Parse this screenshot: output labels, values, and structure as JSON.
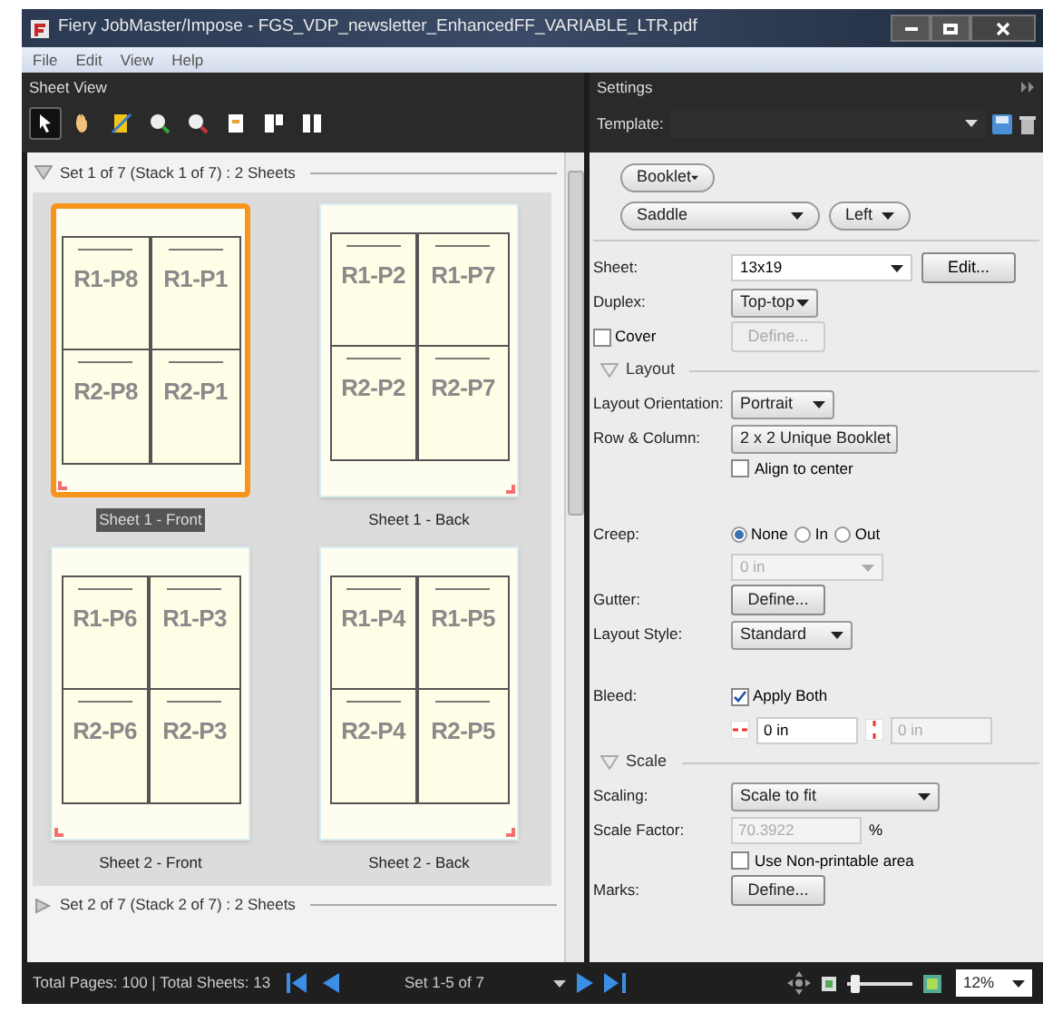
{
  "window": {
    "title": "Fiery JobMaster/Impose - FGS_VDP_newsletter_EnhancedFF_VARIABLE_LTR.pdf"
  },
  "menu": [
    "File",
    "Edit",
    "View",
    "Help"
  ],
  "sheet_view": {
    "title": "Sheet View",
    "tools": [
      {
        "kind": "pointer",
        "selected": true
      },
      {
        "kind": "hand",
        "selected": false
      },
      {
        "kind": "trim",
        "selected": false
      },
      {
        "kind": "zoom-in",
        "selected": false
      },
      {
        "kind": "zoom-out",
        "selected": false
      },
      {
        "kind": "page",
        "selected": false
      },
      {
        "kind": "insert",
        "selected": false
      },
      {
        "kind": "columns",
        "selected": false
      }
    ]
  },
  "sets": [
    {
      "label": "Set 1 of 7 (Stack 1 of 7) : 2 Sheets",
      "expanded": true,
      "sheets": [
        {
          "label": "Sheet 1 - Front",
          "selected": true,
          "marked_left": true,
          "pages": [
            "R1-P8",
            "R1-P1",
            "R2-P8",
            "R2-P1"
          ]
        },
        {
          "label": "Sheet 1 - Back",
          "selected": false,
          "marked_left": false,
          "pages": [
            "R1-P2",
            "R1-P7",
            "R2-P2",
            "R2-P7"
          ]
        },
        {
          "label": "Sheet 2 - Front",
          "selected": false,
          "marked_left": true,
          "pages": [
            "R1-P6",
            "R1-P3",
            "R2-P6",
            "R2-P3"
          ]
        },
        {
          "label": "Sheet 2 - Back",
          "selected": false,
          "marked_left": false,
          "pages": [
            "R1-P4",
            "R1-P5",
            "R2-P4",
            "R2-P5"
          ]
        }
      ]
    },
    {
      "label": "Set 2 of 7 (Stack 2 of 7) : 2 Sheets",
      "expanded": false
    }
  ],
  "status_bar": {
    "totals": "Total Pages: 100 | Total Sheets: 13",
    "range": "Set 1-5 of 7",
    "zoom": "12%",
    "zoom_slider": {
      "level": 0.05
    }
  },
  "settings": {
    "title": "Settings",
    "template_label": "Template:",
    "booklet": "Booklet",
    "binding": "Saddle",
    "edge": "Left",
    "sheet": {
      "label": "Sheet:",
      "value": "13x19",
      "button": "Edit..."
    },
    "duplex": {
      "label": "Duplex:",
      "value": "Top-top"
    },
    "cover": {
      "label": "Cover",
      "checked": false,
      "button": "Define...",
      "button_disabled": true
    },
    "layout": {
      "title": "Layout",
      "expanded": true
    },
    "orientation": {
      "label": "Layout Orientation:",
      "value": "Portrait"
    },
    "row_column": {
      "label": "Row & Column:",
      "value": "2 x 2 Unique Booklet"
    },
    "align": {
      "label": "Align to center",
      "checked": false
    },
    "creep": {
      "label": "Creep:",
      "options": [
        {
          "label": "None",
          "selected": true
        },
        {
          "label": "In",
          "selected": false
        },
        {
          "label": "Out",
          "selected": false
        }
      ],
      "value": "0 in",
      "disabled": true
    },
    "gutter": {
      "label": "Gutter:",
      "button": "Define..."
    },
    "layout_style": {
      "label": "Layout Style:",
      "value": "Standard"
    },
    "bleed": {
      "label": "Bleed:",
      "apply_both": {
        "label": "Apply Both",
        "checked": true
      },
      "horizontal": "0 in",
      "vertical": "0 in",
      "vertical_disabled": true
    },
    "scale": {
      "title": "Scale",
      "expanded": true
    },
    "scaling": {
      "label": "Scaling:",
      "value": "Scale to fit"
    },
    "scale_factor": {
      "label": "Scale Factor:",
      "value": "70.3922",
      "unit": "%",
      "disabled": true
    },
    "non_printable": {
      "label": "Use Non-printable area",
      "checked": false
    },
    "marks": {
      "label": "Marks:",
      "button": "Define..."
    }
  }
}
